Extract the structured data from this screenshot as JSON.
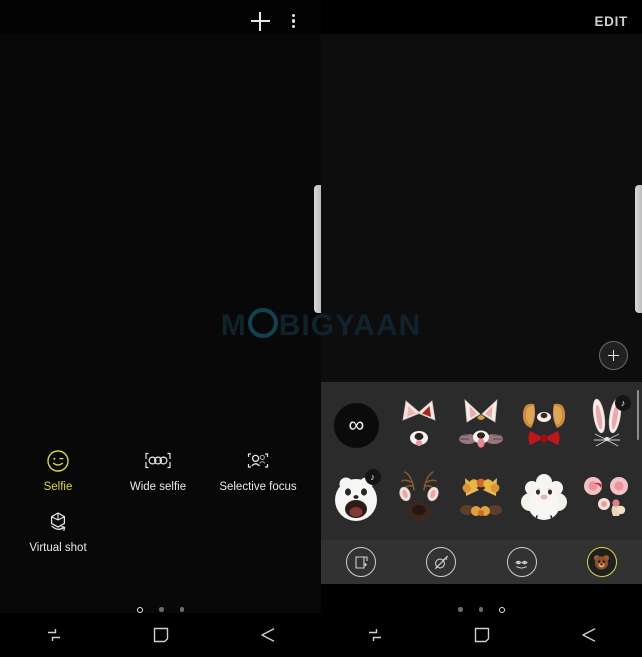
{
  "watermark": {
    "text_before": "M",
    "text_ring": "O",
    "text_after": "BIGYAAN"
  },
  "left_panel": {
    "name": "camera-mode-selector",
    "topbar": {
      "add_label": "+",
      "add_icon": "plus-icon",
      "more_icon": "overflow-menu-icon"
    },
    "modes": [
      {
        "label": "Selfie",
        "icon": "smiley-face-icon",
        "active": true
      },
      {
        "label": "Wide selfie",
        "icon": "wide-selfie-icon",
        "active": false
      },
      {
        "label": "Selective focus",
        "icon": "selective-focus-icon",
        "active": false
      },
      {
        "label": "Virtual shot",
        "icon": "virtual-shot-cube-icon",
        "active": false
      }
    ],
    "page_dots": [
      {
        "active": true
      },
      {
        "active": false
      },
      {
        "active": false
      }
    ],
    "navbar": [
      {
        "name": "recents-button",
        "icon": "recents-icon"
      },
      {
        "name": "home-button",
        "icon": "home-square-icon"
      },
      {
        "name": "back-button",
        "icon": "back-arrow-icon"
      }
    ]
  },
  "right_panel": {
    "name": "ar-stickers-panel",
    "topbar": {
      "edit_label": "EDIT"
    },
    "add_sticker": {
      "name": "add-sticker-button",
      "icon": "plus-circle-icon"
    },
    "sticker_rows": [
      [
        {
          "name": "sticker-no-filter",
          "icon": "infinity-icon",
          "badge": "",
          "selected": false
        },
        {
          "name": "sticker-cat-ears",
          "icon": "cat-ears-mask-icon",
          "badge": "",
          "selected": false
        },
        {
          "name": "sticker-fox-ears",
          "icon": "fox-ears-mask-icon",
          "badge": "",
          "selected": false
        },
        {
          "name": "sticker-dog-bowtie",
          "icon": "dog-ears-bowtie-mask-icon",
          "badge": "",
          "selected": false
        },
        {
          "name": "sticker-bunny-ears",
          "icon": "bunny-ears-mask-icon",
          "badge": "♪",
          "selected": false
        }
      ],
      [
        {
          "name": "sticker-panda-face",
          "icon": "panda-face-mask-icon",
          "badge": "♪",
          "selected": false
        },
        {
          "name": "sticker-deer",
          "icon": "deer-mask-icon",
          "badge": "",
          "selected": false
        },
        {
          "name": "sticker-autumn-crown",
          "icon": "autumn-flower-crown-mask-icon",
          "badge": "",
          "selected": false
        },
        {
          "name": "sticker-sheep",
          "icon": "sheep-mask-icon",
          "badge": "",
          "selected": false
        },
        {
          "name": "sticker-cherry-blossom",
          "icon": "cherry-blossom-mask-icon",
          "badge": "",
          "selected": false
        }
      ]
    ],
    "effect_buttons": [
      {
        "name": "stickers-frame-button",
        "icon": "photo-frame-stamp-icon",
        "active": false
      },
      {
        "name": "beauty-effect-button",
        "icon": "beauty-wand-icon",
        "active": false
      },
      {
        "name": "makeup-effect-button",
        "icon": "makeup-face-icon",
        "active": false
      },
      {
        "name": "mask-effect-button",
        "icon": "bear-mask-icon",
        "active": true
      }
    ],
    "page_dots": [
      {
        "active": false
      },
      {
        "active": false
      },
      {
        "active": true
      }
    ],
    "navbar": [
      {
        "name": "recents-button",
        "icon": "recents-icon"
      },
      {
        "name": "home-button",
        "icon": "home-square-icon"
      },
      {
        "name": "back-button",
        "icon": "back-arrow-icon"
      }
    ]
  },
  "colors": {
    "accent_yellow": "#d7d84a",
    "tray_background": "#2b2b2b",
    "effect_bar_background": "#323232",
    "viewfinder_black": "#0a0a0a",
    "watermark_blue": "#14404f"
  }
}
